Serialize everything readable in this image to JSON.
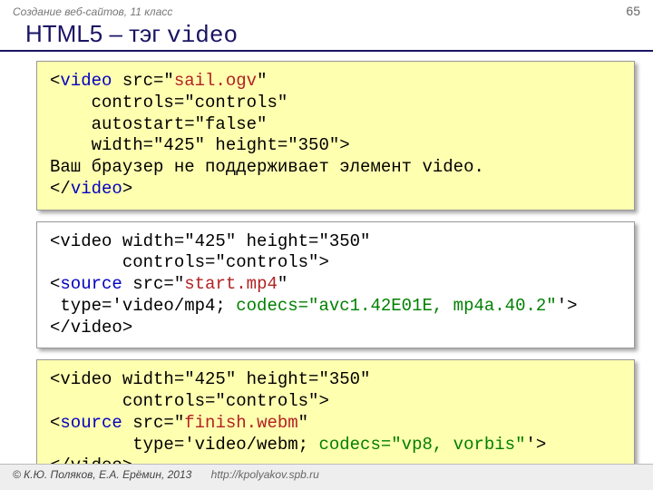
{
  "header": {
    "course": "Создание веб-сайтов, 11 класс",
    "page": "65"
  },
  "title": {
    "prefix": "HTML5 – тэг ",
    "tag": "video"
  },
  "blocks": {
    "b1": {
      "l1a": "<",
      "l1b": "video",
      "l1c": " src=\"",
      "l1d": "sail.ogv",
      "l1e": "\"",
      "l2": "    controls=\"controls\"",
      "l3": "    autostart=\"false\"",
      "l4": "    width=\"425\" height=\"350\">",
      "l5": "Ваш браузер не поддерживает элемент video.",
      "l6a": "</",
      "l6b": "video",
      "l6c": ">"
    },
    "b2": {
      "l1": "<video width=\"425\" height=\"350\"",
      "l2": "       controls=\"controls\">",
      "l3a": "<",
      "l3b": "source",
      "l3c": " src=\"",
      "l3d": "start.mp4",
      "l3e": "\"",
      "l4a": " type='video/mp4; ",
      "l4b": "codecs=\"avc1.42E01E, mp4a.40.2\"",
      "l4c": "'>",
      "l5": "</video>"
    },
    "b3": {
      "l1": "<video width=\"425\" height=\"350\"",
      "l2": "       controls=\"controls\">",
      "l3a": "<",
      "l3b": "source",
      "l3c": " src=\"",
      "l3d": "finish.webm",
      "l3e": "\"",
      "l4a": "        type='video/webm; ",
      "l4b": "codecs=\"vp8, vorbis\"",
      "l4c": "'>",
      "l5": "</video>"
    }
  },
  "footer": {
    "copyright": "© К.Ю. Поляков, Е.А. Ерёмин, 2013",
    "url": "http://kpolyakov.spb.ru"
  }
}
